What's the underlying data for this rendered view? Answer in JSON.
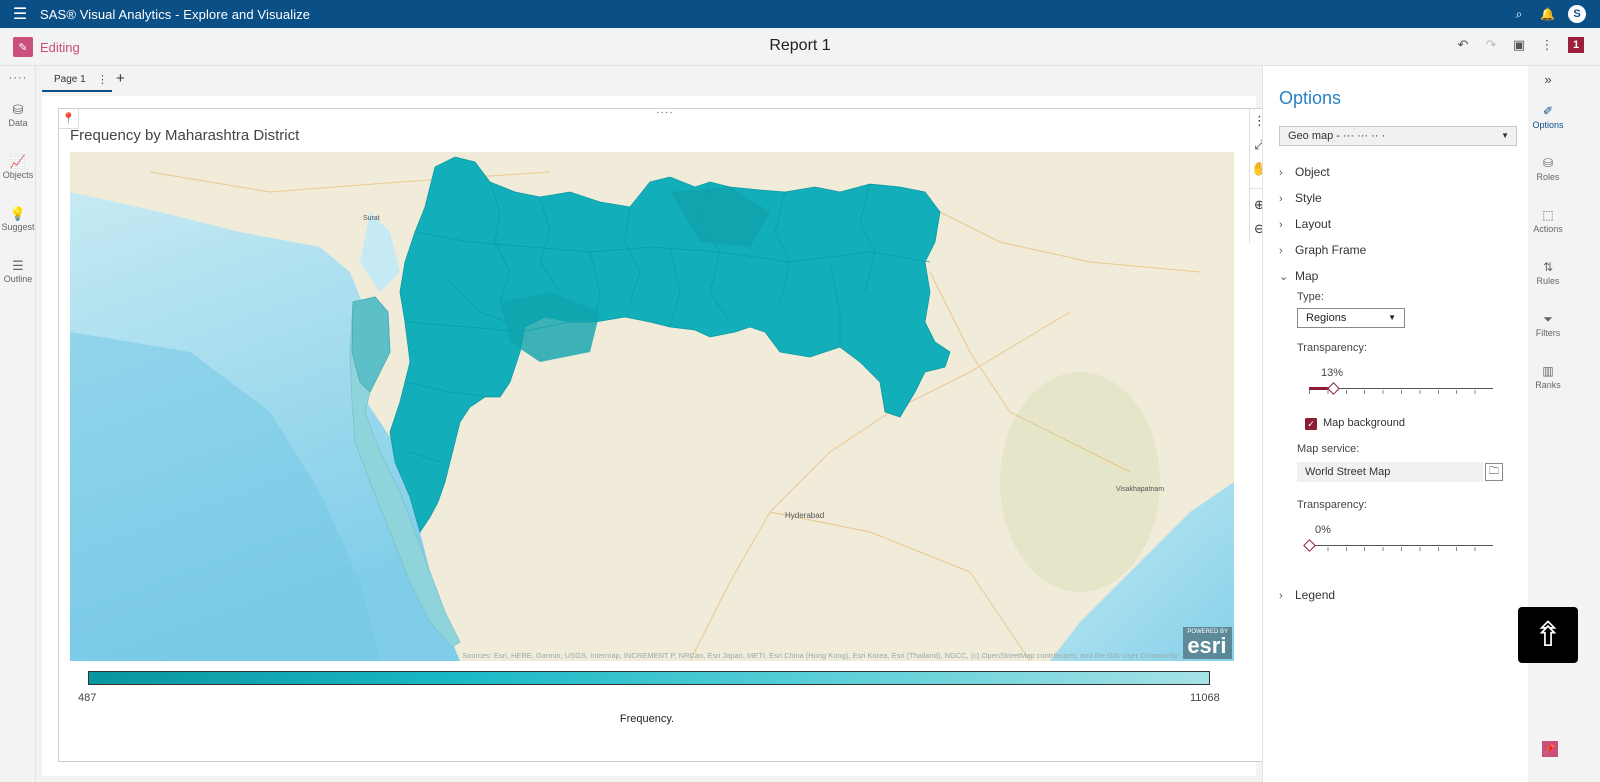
{
  "app": {
    "title": "SAS® Visual Analytics - Explore and Visualize",
    "avatar": "S"
  },
  "report": {
    "mode": "Editing",
    "title": "Report 1",
    "badge": "1"
  },
  "left_rail": {
    "dots": "····",
    "items": [
      {
        "label": "Data",
        "icon": "database-icon"
      },
      {
        "label": "Objects",
        "icon": "chart-icon"
      },
      {
        "label": "Suggest",
        "icon": "lightbulb-icon"
      },
      {
        "label": "Outline",
        "icon": "list-icon"
      }
    ]
  },
  "pages": {
    "tabs": [
      {
        "label": "Page 1"
      }
    ],
    "add": "+"
  },
  "viz": {
    "title": "Frequency by Maharashtra District",
    "drag": "····",
    "legend": {
      "min": "487",
      "max": "11068",
      "title": "Frequency.",
      "colors": [
        "#0a959f",
        "#1ab9c6",
        "#5ccfd8",
        "#a6e2e6"
      ]
    },
    "esri": "esri",
    "esri_powered": "POWERED BY",
    "attribution": "Sources: Esri, HERE, Garmin, USGS, Intermap, INCREMENT P, NRCan, Esri Japan, METI, Esri China (Hong Kong), Esri Korea, Esri (Thailand), NGCC, (c) OpenStreetMap contributors, and the GIS User Community",
    "map_labels": [
      "Hyderabad",
      "Visakhapatnam",
      "Surat"
    ]
  },
  "options": {
    "title": "Options",
    "object_select": "Geo map - ··· ··· ·· ·",
    "sections": [
      "Object",
      "Style",
      "Layout",
      "Graph Frame",
      "Map"
    ],
    "map": {
      "type_label": "Type:",
      "type_value": "Regions",
      "transparency_label": "Transparency:",
      "transparency_value": "13%",
      "transparency_fraction": 0.13,
      "background_label": "Map background",
      "service_label": "Map service:",
      "service_value": "World Street Map",
      "bg_transparency_label": "Transparency:",
      "bg_transparency_value": "0%",
      "bg_transparency_fraction": 0.0
    },
    "legend_section": "Legend"
  },
  "right_rail": {
    "collapse": "»",
    "items": [
      {
        "label": "Options",
        "icon": "options-icon",
        "active": true
      },
      {
        "label": "Roles",
        "icon": "roles-icon"
      },
      {
        "label": "Actions",
        "icon": "actions-icon"
      },
      {
        "label": "Rules",
        "icon": "rules-icon"
      },
      {
        "label": "Filters",
        "icon": "filter-icon"
      },
      {
        "label": "Ranks",
        "icon": "ranks-icon"
      }
    ]
  },
  "colors": {
    "topbar": "#0b4f87",
    "accent": "#c94f7c",
    "region_fill": "#12aeb9",
    "coastal_fill": "#8fd4da",
    "water": "#a9dcef"
  }
}
